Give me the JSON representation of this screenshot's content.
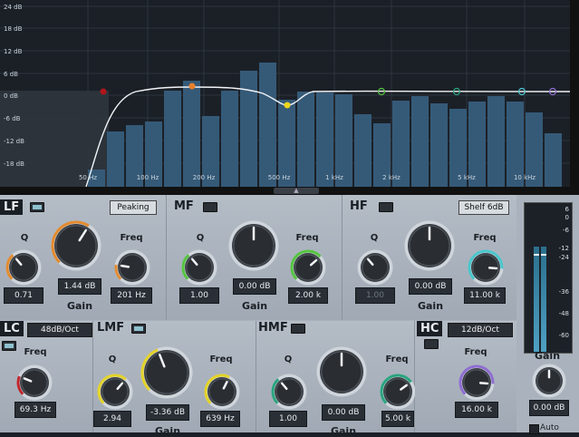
{
  "eq_display": {
    "db_labels": [
      "24 dB",
      "18 dB",
      "12 dB",
      "6 dB",
      "0 dB",
      "-6 dB",
      "-12 dB",
      "-18 dB"
    ],
    "freq_labels": [
      "50 Hz",
      "100 Hz",
      "200 Hz",
      "500 Hz",
      "1 kHz",
      "2 kHz",
      "5 kHz",
      "10 kHz"
    ]
  },
  "bands": {
    "lf": {
      "title": "LF",
      "mode": "Peaking",
      "q_label": "Q",
      "q_value": "0.71",
      "gain_label": "Gain",
      "gain_value": "1.44 dB",
      "freq_label": "Freq",
      "freq_value": "201 Hz",
      "accent": "#e38b2f"
    },
    "mf": {
      "title": "MF",
      "q_label": "Q",
      "q_value": "1.00",
      "gain_label": "Gain",
      "gain_value": "0.00 dB",
      "freq_label": "Freq",
      "freq_value": "2.00 k",
      "accent": "#56c441"
    },
    "hf": {
      "title": "HF",
      "mode": "Shelf 6dB",
      "q_label": "Q",
      "q_value": "1.00",
      "gain_label": "Gain",
      "gain_value": "0.00 dB",
      "freq_label": "Freq",
      "freq_value": "11.00 k",
      "accent": "#49c6cc"
    },
    "lc": {
      "title": "LC",
      "mode": "48dB/Oct",
      "freq_label": "Freq",
      "freq_value": "69.3 Hz",
      "accent": "#c0262c"
    },
    "lmf": {
      "title": "LMF",
      "q_label": "Q",
      "q_value": "2.94",
      "gain_label": "Gain",
      "gain_value": "-3.36 dB",
      "freq_label": "Freq",
      "freq_value": "639 Hz",
      "accent": "#e3d328"
    },
    "hmf": {
      "title": "HMF",
      "q_label": "Q",
      "q_value": "1.00",
      "gain_label": "Gain",
      "gain_value": "0.00 dB",
      "freq_label": "Freq",
      "freq_value": "5.00 k",
      "accent": "#2aa57f"
    },
    "hc": {
      "title": "HC",
      "mode": "12dB/Oct",
      "freq_label": "Freq",
      "freq_value": "16.00 k",
      "accent": "#8e6dd1"
    }
  },
  "output": {
    "meter_labels": [
      "6",
      "0",
      "-6",
      "-12",
      "-24",
      "-36",
      "-48",
      "-60"
    ],
    "gain_label": "Gain",
    "gain_value": "0.00 dB",
    "auto_label": "Auto"
  }
}
